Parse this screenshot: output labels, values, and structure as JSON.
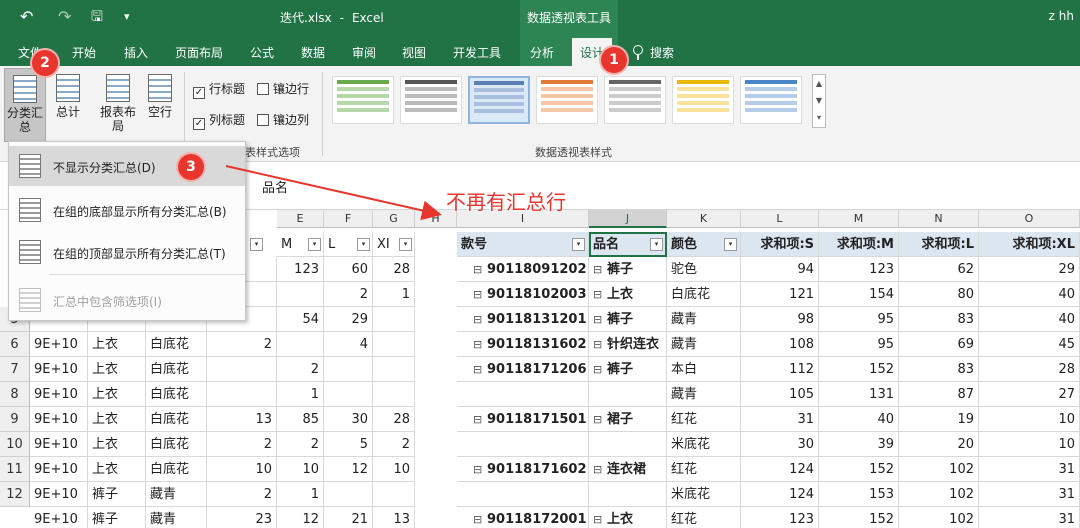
{
  "window": {
    "title_file": "迭代.xlsx",
    "title_sep": "-",
    "title_app": "Excel",
    "context_tools": "数据透视表工具",
    "user": "z hh"
  },
  "quick_access": {
    "undo": "↶",
    "redo": "↷",
    "save": "🖫",
    "customize": "▾"
  },
  "tabs": [
    "文件",
    "开始",
    "插入",
    "页面布局",
    "公式",
    "数据",
    "审阅",
    "视图",
    "开发工具",
    "分析",
    "设计"
  ],
  "active_tab": "设计",
  "search_label": "搜索",
  "ribbon": {
    "subtotals_label": "分类汇总",
    "grand_totals_label": "总计",
    "report_layout_label": "报表布局",
    "blank_rows_label": "空行",
    "row_headers": "行标题",
    "column_headers": "列标题",
    "banded_rows": "镶边行",
    "banded_columns": "镶边列",
    "options_group_label": "表样式选项",
    "styles_group_label": "数据透视表样式",
    "row_headers_checked": true,
    "column_headers_checked": true
  },
  "formula_bar": {
    "value": "品名"
  },
  "menu": {
    "items": [
      {
        "label": "不显示分类汇总(D)",
        "disabled": false
      },
      {
        "label": "在组的底部显示所有分类汇总(B)",
        "disabled": false
      },
      {
        "label": "在组的顶部显示所有分类汇总(T)",
        "disabled": false
      },
      {
        "label": "汇总中包含筛选项(I)",
        "disabled": true
      }
    ]
  },
  "annotations": {
    "badge1": "1",
    "badge2": "2",
    "badge3": "3",
    "note": "不再有汇总行",
    "color": "#e8352e"
  },
  "grid": {
    "col_headers": [
      "E",
      "F",
      "G",
      "H",
      "I",
      "J",
      "K",
      "L",
      "M",
      "N",
      "O"
    ],
    "row_numbers": [
      "5",
      "6",
      "7",
      "8",
      "9",
      "10",
      "11",
      "12"
    ],
    "left_header": [
      "M",
      "L",
      "XI"
    ],
    "left_rows": [
      [
        "",
        "",
        "",
        "",
        "123",
        "60",
        "28"
      ],
      [
        "",
        "",
        "",
        "",
        "",
        "2",
        "1"
      ],
      [
        "",
        "",
        "",
        "",
        "54",
        "29",
        ""
      ],
      [
        "9E+10",
        "上衣",
        "白底花",
        "2",
        "",
        "4",
        ""
      ],
      [
        "9E+10",
        "上衣",
        "白底花",
        "",
        "2",
        "",
        ""
      ],
      [
        "9E+10",
        "上衣",
        "白底花",
        "",
        "1",
        "",
        ""
      ],
      [
        "9E+10",
        "上衣",
        "白底花",
        "13",
        "85",
        "30",
        "28"
      ],
      [
        "9E+10",
        "上衣",
        "白底花",
        "2",
        "2",
        "5",
        "2"
      ],
      [
        "9E+10",
        "上衣",
        "白底花",
        "10",
        "10",
        "12",
        "10"
      ],
      [
        "9E+10",
        "裤子",
        "藏青",
        "2",
        "1",
        "",
        ""
      ],
      [
        "9E+10",
        "裤子",
        "藏青",
        "23",
        "12",
        "21",
        "13"
      ]
    ],
    "pivot_header": [
      "款号",
      "品名",
      "颜色",
      "求和项:S",
      "求和项:M",
      "求和项:L",
      "求和项:XL"
    ],
    "pivot_rows": [
      [
        "90118091202",
        "裤子",
        "驼色",
        "94",
        "123",
        "62",
        "29"
      ],
      [
        "90118102003",
        "上衣",
        "白底花",
        "121",
        "154",
        "80",
        "40"
      ],
      [
        "90118131201",
        "裤子",
        "藏青",
        "98",
        "95",
        "83",
        "40"
      ],
      [
        "90118131602",
        "针织连衣",
        "藏青",
        "108",
        "95",
        "69",
        "45"
      ],
      [
        "90118171206",
        "裤子",
        "本白",
        "112",
        "152",
        "83",
        "28"
      ],
      [
        "",
        "",
        "藏青",
        "105",
        "131",
        "87",
        "27"
      ],
      [
        "90118171501",
        "裙子",
        "红花",
        "31",
        "40",
        "19",
        "10"
      ],
      [
        "",
        "",
        "米底花",
        "30",
        "39",
        "20",
        "10"
      ],
      [
        "90118171602",
        "连衣裙",
        "红花",
        "124",
        "152",
        "102",
        "31"
      ],
      [
        "",
        "",
        "米底花",
        "124",
        "153",
        "102",
        "31"
      ],
      [
        "90118172001",
        "上衣",
        "红花",
        "123",
        "152",
        "102",
        "31"
      ]
    ]
  }
}
